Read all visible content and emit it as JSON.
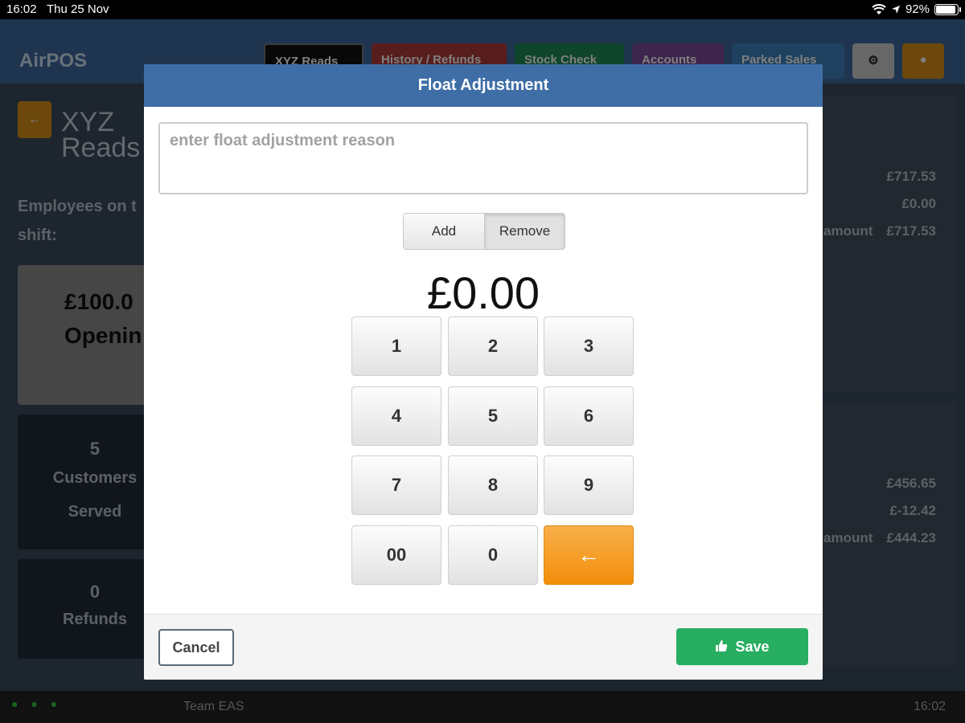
{
  "status": {
    "time": "16:02",
    "date": "Thu 25 Nov",
    "battery": "92%"
  },
  "app": {
    "brand": "AirPOS",
    "nav": [
      "XYZ Reads",
      "History / Refunds",
      "Stock Check",
      "Accounts",
      "Parked Sales"
    ],
    "page_title_line1": "XYZ",
    "page_title_line2": "Reads",
    "employees_label": "Employees on t",
    "shift_label": "shift:",
    "opening_amount": "£100.0",
    "opening_label": "Openin",
    "customers_count": "5",
    "customers_label": "Customers",
    "served_label": "Served",
    "refunds_count": "0",
    "refunds_label": "Refunds",
    "right_values_top": [
      "£717.53",
      "£0.00",
      "£717.53"
    ],
    "right_values_bottom": [
      "£456.65",
      "£-12.42",
      "£444.23"
    ],
    "amount_label": "amount",
    "footer_team": "Team EAS",
    "footer_time": "16:02"
  },
  "modal": {
    "title": "Float Adjustment",
    "reason_placeholder": "enter float adjustment reason",
    "toggle": {
      "add": "Add",
      "remove": "Remove",
      "selected": "Remove"
    },
    "amount": "£0.00",
    "keys": [
      "1",
      "2",
      "3",
      "4",
      "5",
      "6",
      "7",
      "8",
      "9",
      "00",
      "0",
      "←"
    ],
    "cancel_label": "Cancel",
    "save_label": "Save"
  },
  "colors": {
    "header": "#3f6ea6",
    "save": "#27ae60",
    "backspace": "#f28e0a"
  }
}
